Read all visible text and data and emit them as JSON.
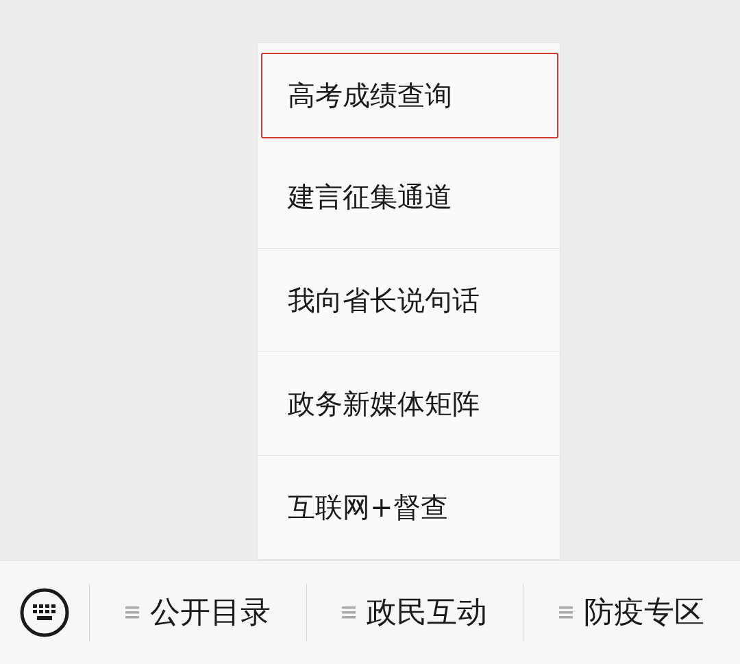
{
  "menu": {
    "items": [
      {
        "label": "高考成绩查询",
        "selected": true
      },
      {
        "label": "建言征集通道",
        "selected": false
      },
      {
        "label": "我向省长说句话",
        "selected": false
      },
      {
        "label": "政务新媒体矩阵",
        "selected": false
      },
      {
        "label": "互联网+督查",
        "selected": false
      }
    ]
  },
  "bottom_bar": {
    "tabs": [
      {
        "label": "公开目录"
      },
      {
        "label": "政民互动"
      },
      {
        "label": "防疫专区"
      }
    ]
  }
}
